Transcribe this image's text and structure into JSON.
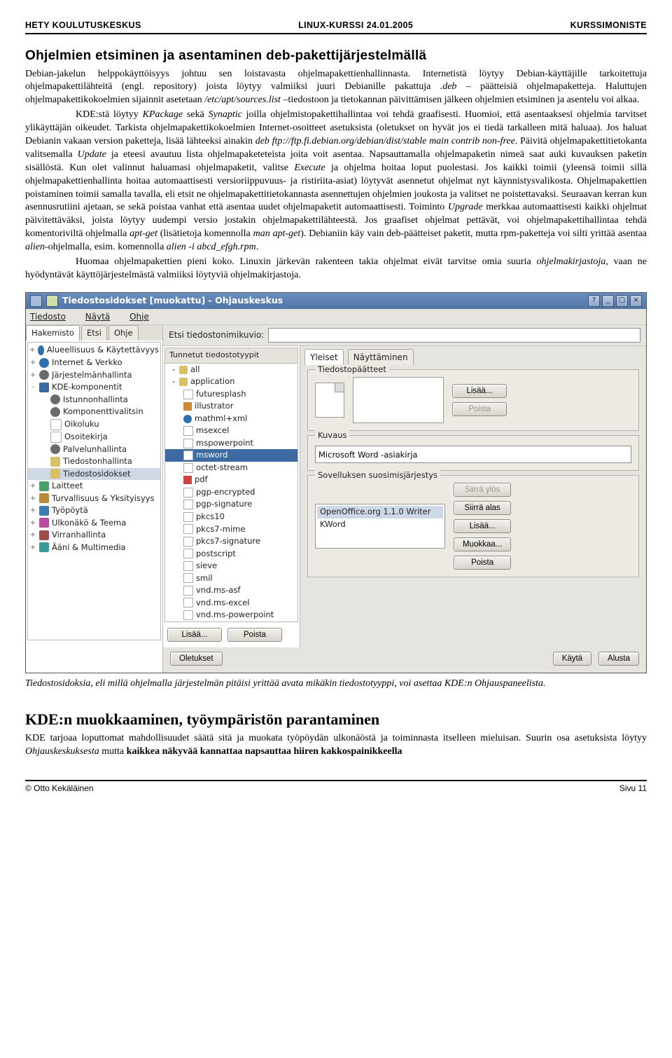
{
  "header": {
    "left": "HETY KOULUTUSKESKUS",
    "center": "LINUX-KURSSI 24.01.2005",
    "right": "KURSSIMONISTE"
  },
  "section1": {
    "title": "Ohjelmien etsiminen ja asentaminen deb-pakettijärjestelmällä",
    "para1a": "Debian-jakelun helppokäyttöisyys johtuu sen loistavasta ohjelmapakettienhallinnasta. Internetistä löytyy Debian-käyttäjille tarkoitettuja ohjelmapakettilähteitä (engl. repository) joista löytyy valmiiksi juuri Debianille pakattuja ",
    "para1b": ".deb",
    "para1c": " – päätteisiä ohjelmapaketteja. Haluttujen ohjelmapakettikokoelmien sijainnit asetetaan ",
    "para1d": "/etc/apt/sources.list",
    "para1e": " –tiedostoon ja tietokannan päivittämisen jälkeen ohjelmien etsiminen ja asentelu voi alkaa.",
    "para2a": "KDE:stä löytyy ",
    "para2b": "KPackage",
    "para2c": " sekä ",
    "para2d": "Synaptic",
    "para2e": " joilla ohjelmistopakettihallintaa voi tehdä graafisesti. Huomioi, että asentaaksesi ohjelmia tarvitset ylikäyttäjän oikeudet. Tarkista ohjelmapakettikokoelmien Internet-osoitteet asetuksista (oletukset on hyvät jos ei tiedä tarkalleen mitä haluaa). Jos haluat Debianin vakaan version paketteja, lisää lähteeksi ainakin ",
    "para2f": "deb ftp://ftp.fi.debian.org/debian/dist/stable main contrib non-free",
    "para2g": ". Päivitä ohjelmapakettitietokanta valitsemalla ",
    "para2h": "Update",
    "para2i": " ja eteesi avautuu lista ohjelmapaketeteista joita voit asentaa. Napsauttamalla ohjelmapaketin nimeä saat auki kuvauksen paketin sisällöstä. Kun olet valinnut haluamasi ohjelmapaketit, valitse ",
    "para2j": "Execute",
    "para2k": " ja ohjelma hoitaa loput puolestasi. Jos kaikki toimii (yleensä toimii sillä ohjelmapakettienhallinta hoitaa automaattisesti versioriippuvuus- ja ristiriita-asiat) löytyvät asennetut ohjelmat nyt käynnistysvalikosta. Ohjelmapakettien poistaminen toimii samalla tavalla, eli etsit ne ohjelmapakettitietokannasta asennettujen ohjelmien joukosta ja valitset ne poistettavaksi. Seuraavan kerran kun asennusrutiini ajetaan, se sekä poistaa vanhat että asentaa uudet ohjelmapaketit automaattisesti. Toiminto ",
    "para2l": "Upgrade",
    "para2m": " merkkaa automaattisesti kaikki ohjelmat päivitettäväksi, joista löytyy uudempi versio jostakin ohjelmapakettilähteestä. Jos graafiset ohjelmat pettävät, voi ohjelmapakettihallintaa tehdä komentoriviltä ohjelmalla ",
    "para2n": "apt-get",
    "para2o": " (lisätietoja komennolla ",
    "para2p": "man apt-get",
    "para2q": "). Debianiin käy vain deb-päätteiset paketit, mutta rpm-paketteja voi silti yrittää asentaa ",
    "para2r": "alien",
    "para2s": "-ohjelmalla, esim. komennolla ",
    "para2t": "alien -i abcd_efgh.rpm",
    "para2u": ".",
    "para3a": "Huomaa ohjelmapakettien pieni koko. Linuxin järkevän rakenteen takia ohjelmat eivät tarvitse omia suuria ",
    "para3b": "ohjelmakirjastoja",
    "para3c": ", vaan ne hyödyntävät käyttöjärjestelmästä valmiiksi löytyviä ohjelmakirjastoja."
  },
  "shot": {
    "title": "Tiedostosidokset [muokattu] - Ohjauskeskus",
    "menus": [
      "Tiedosto",
      "Näytä",
      "Ohje"
    ],
    "left_tabs": [
      "Hakemisto",
      "Etsi",
      "Ohje"
    ],
    "tree": [
      {
        "exp": "+",
        "icon": "globe",
        "label": "Alueellisuus & Käytettävyys"
      },
      {
        "exp": "+",
        "icon": "globe",
        "label": "Internet & Verkko"
      },
      {
        "exp": "+",
        "icon": "gear",
        "label": "Järjestelmänhallinta"
      },
      {
        "exp": "-",
        "icon": "kde",
        "label": "KDE-komponentit"
      },
      {
        "exp": "",
        "indent": 1,
        "icon": "gear",
        "label": "Istunnonhallinta"
      },
      {
        "exp": "",
        "indent": 1,
        "icon": "gear",
        "label": "Komponenttivalitsin"
      },
      {
        "exp": "",
        "indent": 1,
        "icon": "doc",
        "label": "Oikoluku"
      },
      {
        "exp": "",
        "indent": 1,
        "icon": "doc",
        "label": "Osoitekirja"
      },
      {
        "exp": "",
        "indent": 1,
        "icon": "gear",
        "label": "Palvelunhallinta"
      },
      {
        "exp": "",
        "indent": 1,
        "icon": "folder",
        "label": "Tiedostonhallinta"
      },
      {
        "exp": "",
        "indent": 1,
        "icon": "folder",
        "label": "Tiedostosidokset",
        "sel": true
      },
      {
        "exp": "+",
        "icon": "dev",
        "label": "Laitteet"
      },
      {
        "exp": "+",
        "icon": "lock",
        "label": "Turvallisuus & Yksityisyys"
      },
      {
        "exp": "+",
        "icon": "desk",
        "label": "Työpöytä"
      },
      {
        "exp": "+",
        "icon": "paint",
        "label": "Ulkonäkö & Teema"
      },
      {
        "exp": "+",
        "icon": "power",
        "label": "Virranhallinta"
      },
      {
        "exp": "+",
        "icon": "snd",
        "label": "Ääni & Multimedia"
      }
    ],
    "search_label": "Etsi tiedostonimikuvio:",
    "mid_header": "Tunnetut tiedostotyypit",
    "mime_list": [
      {
        "exp": "-",
        "icon": "folder",
        "label": "all"
      },
      {
        "exp": "-",
        "icon": "folder",
        "label": "application",
        "indent": 0
      },
      {
        "icon": "doc",
        "label": "futuresplash",
        "indent": 1
      },
      {
        "icon": "img",
        "label": "illustrator",
        "indent": 1
      },
      {
        "icon": "globe",
        "label": "mathml+xml",
        "indent": 1
      },
      {
        "icon": "doc",
        "label": "msexcel",
        "indent": 1
      },
      {
        "icon": "doc",
        "label": "mspowerpoint",
        "indent": 1
      },
      {
        "icon": "doc",
        "label": "msword",
        "indent": 1,
        "sel": true
      },
      {
        "icon": "doc",
        "label": "octet-stream",
        "indent": 1
      },
      {
        "icon": "pdf",
        "label": "pdf",
        "indent": 1
      },
      {
        "icon": "doc",
        "label": "pgp-encrypted",
        "indent": 1
      },
      {
        "icon": "doc",
        "label": "pgp-signature",
        "indent": 1
      },
      {
        "icon": "doc",
        "label": "pkcs10",
        "indent": 1
      },
      {
        "icon": "doc",
        "label": "pkcs7-mime",
        "indent": 1
      },
      {
        "icon": "doc",
        "label": "pkcs7-signature",
        "indent": 1
      },
      {
        "icon": "doc",
        "label": "postscript",
        "indent": 1
      },
      {
        "icon": "doc",
        "label": "sieve",
        "indent": 1
      },
      {
        "icon": "doc",
        "label": "smil",
        "indent": 1
      },
      {
        "icon": "doc",
        "label": "vnd.ms-asf",
        "indent": 1
      },
      {
        "icon": "doc",
        "label": "vnd.ms-excel",
        "indent": 1
      },
      {
        "icon": "doc",
        "label": "vnd.ms-powerpoint",
        "indent": 1
      }
    ],
    "mid_add": "Lisää...",
    "mid_remove": "Poista",
    "right_tabs": [
      "Yleiset",
      "Näyttäminen"
    ],
    "grp_ext": "Tiedostopäätteet",
    "btn_add": "Lisää...",
    "btn_del": "Poista",
    "grp_desc": "Kuvaus",
    "desc_value": "Microsoft Word -asiakirja",
    "grp_pref": "Sovelluksen suosimisjärjestys",
    "apps": [
      "OpenOffice.org 1.1.0 Writer",
      "KWord"
    ],
    "btn_up": "Siirrä ylös",
    "btn_down": "Siirrä alas",
    "btn_add2": "Lisää...",
    "btn_edit": "Muokkaa...",
    "btn_del2": "Poista",
    "btn_defaults": "Oletukset",
    "btn_apply": "Käytä",
    "btn_reset": "Alusta"
  },
  "caption": "Tiedostosidoksia, eli millä ohjelmalla järjestelmän pitäisi yrittää avata mikäkin tiedostotyyppi, voi asettaa KDE:n Ohjauspaneelista.",
  "section2": {
    "title": "KDE:n muokkaaminen, työympäristön parantaminen",
    "p1a": "KDE tarjoaa loputtomat mahdollisuudet säätä sitä ja muokata työpöydän ulkonäöstä ja toiminnasta itselleen mieluisan. Suurin osa asetuksista löytyy ",
    "p1b": "Ohjauskeskuksesta",
    "p1c": " mutta ",
    "p1d": "kaikkea näkyvää kannattaa napsauttaa hiiren kakkospainikkeella"
  },
  "footer": {
    "left": "© Otto Kekäläinen",
    "right": "Sivu 11"
  }
}
